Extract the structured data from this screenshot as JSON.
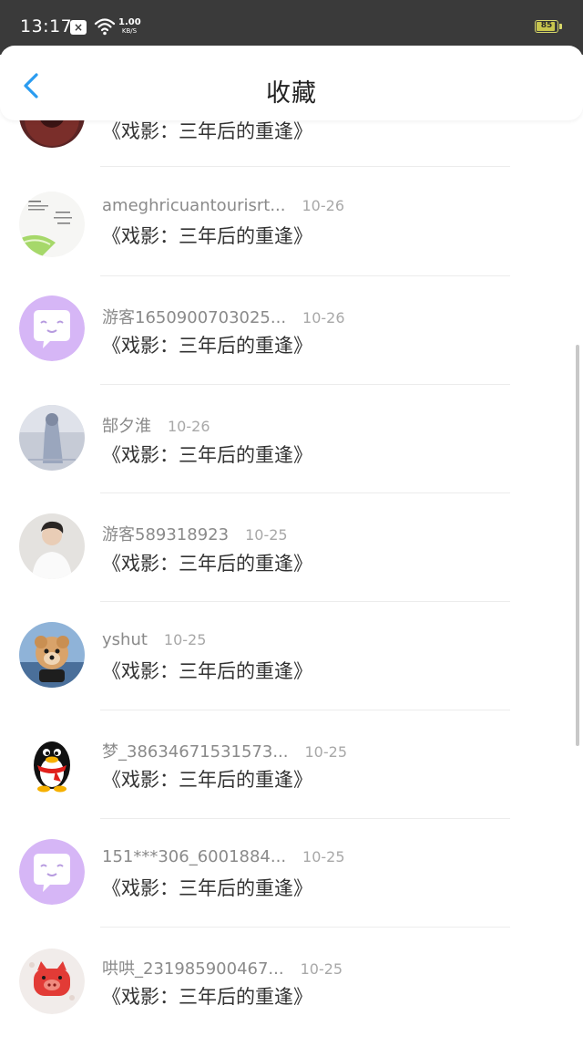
{
  "status_bar": {
    "time": "13:17",
    "notification_icon": "x-box-icon",
    "speed_value": "1.00",
    "speed_unit": "KB/S",
    "battery": "85"
  },
  "header": {
    "title": "收藏"
  },
  "items": [
    {
      "name": "",
      "date": "",
      "content": "《戏影：三年后的重逢》",
      "avatar": "dark-red-avatar"
    },
    {
      "name": "ameghricuantourisrt...",
      "date": "10-26",
      "content": "《戏影：三年后的重逢》",
      "avatar": "note-lime-avatar"
    },
    {
      "name": "游客1650900703025...",
      "date": "10-26",
      "content": "《戏影：三年后的重逢》",
      "avatar": "purple-chat-avatar"
    },
    {
      "name": "郜夕淮",
      "date": "10-26",
      "content": "《戏影：三年后的重逢》",
      "avatar": "photo-blue-avatar"
    },
    {
      "name": "游客589318923",
      "date": "10-25",
      "content": "《戏影：三年后的重逢》",
      "avatar": "photo-person-avatar"
    },
    {
      "name": "yshut",
      "date": "10-25",
      "content": "《戏影：三年后的重逢》",
      "avatar": "dog-avatar"
    },
    {
      "name": "梦_38634671531573...",
      "date": "10-25",
      "content": "《戏影：三年后的重逢》",
      "avatar": "penguin-avatar"
    },
    {
      "name": "151***306_6001884...",
      "date": "10-25",
      "content": "《戏影：三年后的重逢》",
      "avatar": "purple-chat-avatar"
    },
    {
      "name": "哄哄_231985900467...",
      "date": "10-25",
      "content": "《戏影：三年后的重逢》",
      "avatar": "red-pig-avatar"
    }
  ],
  "colors": {
    "accent": "#2a9cf0",
    "status_bar": "#3a3a3a",
    "avatar_purple": "#d6b6f6"
  }
}
